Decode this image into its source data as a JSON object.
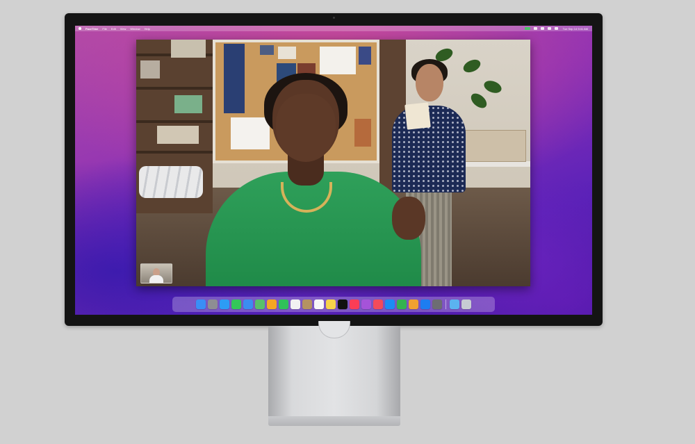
{
  "menubar": {
    "app_name": "FaceTime",
    "items": [
      "File",
      "Edit",
      "View",
      "Window",
      "Help"
    ],
    "clock": "Tue Sep 14 9:41 AM"
  },
  "facetime": {
    "self_view_label": "Self view"
  },
  "dock": {
    "apps": [
      {
        "name": "finder-icon",
        "color": "#3a8ef6"
      },
      {
        "name": "launchpad-icon",
        "color": "#8e8e93"
      },
      {
        "name": "safari-icon",
        "color": "#2d9cf4"
      },
      {
        "name": "messages-icon",
        "color": "#34c759"
      },
      {
        "name": "mail-icon",
        "color": "#3b8df0"
      },
      {
        "name": "maps-icon",
        "color": "#58c06a"
      },
      {
        "name": "photos-icon",
        "color": "#f5a623"
      },
      {
        "name": "facetime-icon",
        "color": "#30c15a"
      },
      {
        "name": "calendar-icon",
        "color": "#f2f2f2"
      },
      {
        "name": "contacts-icon",
        "color": "#b49262"
      },
      {
        "name": "reminders-icon",
        "color": "#f7f7f7"
      },
      {
        "name": "notes-icon",
        "color": "#f6d24a"
      },
      {
        "name": "tv-icon",
        "color": "#111111"
      },
      {
        "name": "music-icon",
        "color": "#fb3d56"
      },
      {
        "name": "podcasts-icon",
        "color": "#a553d9"
      },
      {
        "name": "news-icon",
        "color": "#f34b5a"
      },
      {
        "name": "app-store-icon",
        "color": "#1c8cf4"
      },
      {
        "name": "numbers-icon",
        "color": "#35b350"
      },
      {
        "name": "pages-icon",
        "color": "#f0a130"
      },
      {
        "name": "keynote-icon",
        "color": "#1e7df0"
      },
      {
        "name": "system-preferences-icon",
        "color": "#6d6d72"
      }
    ],
    "trailing": [
      {
        "name": "downloads-folder-icon",
        "color": "#5bb3f0"
      },
      {
        "name": "trash-icon",
        "color": "#c7ccd3"
      }
    ]
  }
}
